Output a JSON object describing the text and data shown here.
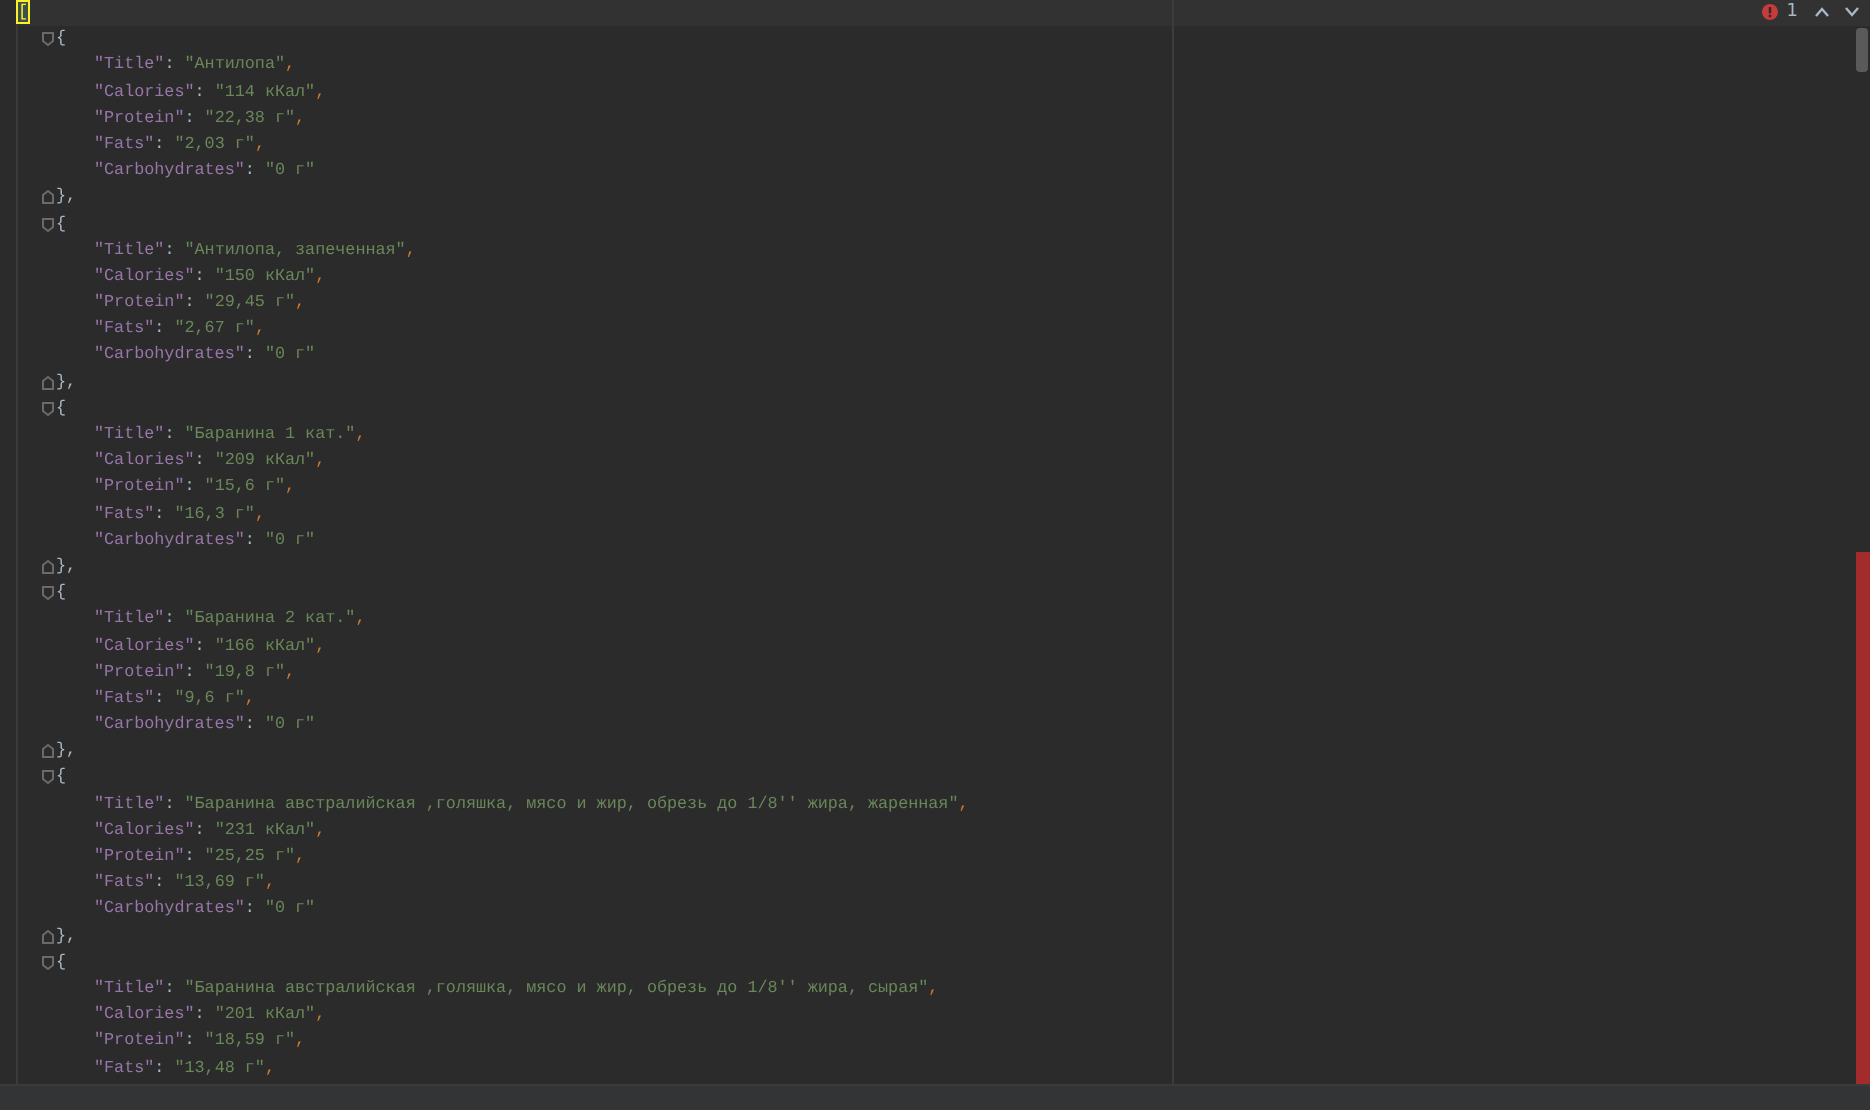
{
  "editor": {
    "document": {
      "open": "[",
      "highlighted": true,
      "items": [
        {
          "open": "{",
          "close": "},",
          "fields": [
            {
              "key": "\"Title\"",
              "separator": ":",
              "value": "\"Антилопа\"",
              "trailing": ","
            },
            {
              "key": "\"Calories\"",
              "separator": ":",
              "value": "\"114 кКал\"",
              "trailing": ","
            },
            {
              "key": "\"Protein\"",
              "separator": ":",
              "value": "\"22,38 г\"",
              "trailing": ","
            },
            {
              "key": "\"Fats\"",
              "separator": ":",
              "value": "\"2,03 г\"",
              "trailing": ","
            },
            {
              "key": "\"Carbohydrates\"",
              "separator": ":",
              "value": "\"0 г\""
            }
          ]
        },
        {
          "open": "{",
          "close": "},",
          "fields": [
            {
              "key": "\"Title\"",
              "separator": ":",
              "value": "\"Антилопа, запеченная\"",
              "trailing": ","
            },
            {
              "key": "\"Calories\"",
              "separator": ":",
              "value": "\"150 кКал\"",
              "trailing": ","
            },
            {
              "key": "\"Protein\"",
              "separator": ":",
              "value": "\"29,45 г\"",
              "trailing": ","
            },
            {
              "key": "\"Fats\"",
              "separator": ":",
              "value": "\"2,67 г\"",
              "trailing": ","
            },
            {
              "key": "\"Carbohydrates\"",
              "separator": ":",
              "value": "\"0 г\""
            }
          ]
        },
        {
          "open": "{",
          "close": "},",
          "fields": [
            {
              "key": "\"Title\"",
              "separator": ":",
              "value": "\"Баранина 1 кат.\"",
              "trailing": ","
            },
            {
              "key": "\"Calories\"",
              "separator": ":",
              "value": "\"209 кКал\"",
              "trailing": ","
            },
            {
              "key": "\"Protein\"",
              "separator": ":",
              "value": "\"15,6 г\"",
              "trailing": ","
            },
            {
              "key": "\"Fats\"",
              "separator": ":",
              "value": "\"16,3 г\"",
              "trailing": ","
            },
            {
              "key": "\"Carbohydrates\"",
              "separator": ":",
              "value": "\"0 г\""
            }
          ]
        },
        {
          "open": "{",
          "close": "},",
          "fields": [
            {
              "key": "\"Title\"",
              "separator": ":",
              "value": "\"Баранина 2 кат.\"",
              "trailing": ","
            },
            {
              "key": "\"Calories\"",
              "separator": ":",
              "value": "\"166 кКал\"",
              "trailing": ","
            },
            {
              "key": "\"Protein\"",
              "separator": ":",
              "value": "\"19,8 г\"",
              "trailing": ","
            },
            {
              "key": "\"Fats\"",
              "separator": ":",
              "value": "\"9,6 г\"",
              "trailing": ","
            },
            {
              "key": "\"Carbohydrates\"",
              "separator": ":",
              "value": "\"0 г\""
            }
          ]
        },
        {
          "open": "{",
          "close": "},",
          "fields": [
            {
              "key": "\"Title\"",
              "separator": ":",
              "value": "\"Баранина австралийская ,голяшка, мясо и жир, обрезь до 1/8'' жира, жаренная\"",
              "trailing": ","
            },
            {
              "key": "\"Calories\"",
              "separator": ":",
              "value": "\"231 кКал\"",
              "trailing": ","
            },
            {
              "key": "\"Protein\"",
              "separator": ":",
              "value": "\"25,25 г\"",
              "trailing": ","
            },
            {
              "key": "\"Fats\"",
              "separator": ":",
              "value": "\"13,69 г\"",
              "trailing": ","
            },
            {
              "key": "\"Carbohydrates\"",
              "separator": ":",
              "value": "\"0 г\""
            }
          ]
        },
        {
          "open": "{",
          "fields": [
            {
              "key": "\"Title\"",
              "separator": ":",
              "value": "\"Баранина австралийская ,голяшка, мясо и жир, обрезь до 1/8'' жира, сырая\"",
              "trailing": ","
            },
            {
              "key": "\"Calories\"",
              "separator": ":",
              "value": "\"201 кКал\"",
              "trailing": ","
            },
            {
              "key": "\"Protein\"",
              "separator": ":",
              "value": "\"18,59 г\"",
              "trailing": ","
            },
            {
              "key": "\"Fats\"",
              "separator": ":",
              "value": "\"13,48 г\"",
              "trailing": ","
            }
          ]
        }
      ]
    },
    "inspections": {
      "error_count": "1"
    }
  }
}
